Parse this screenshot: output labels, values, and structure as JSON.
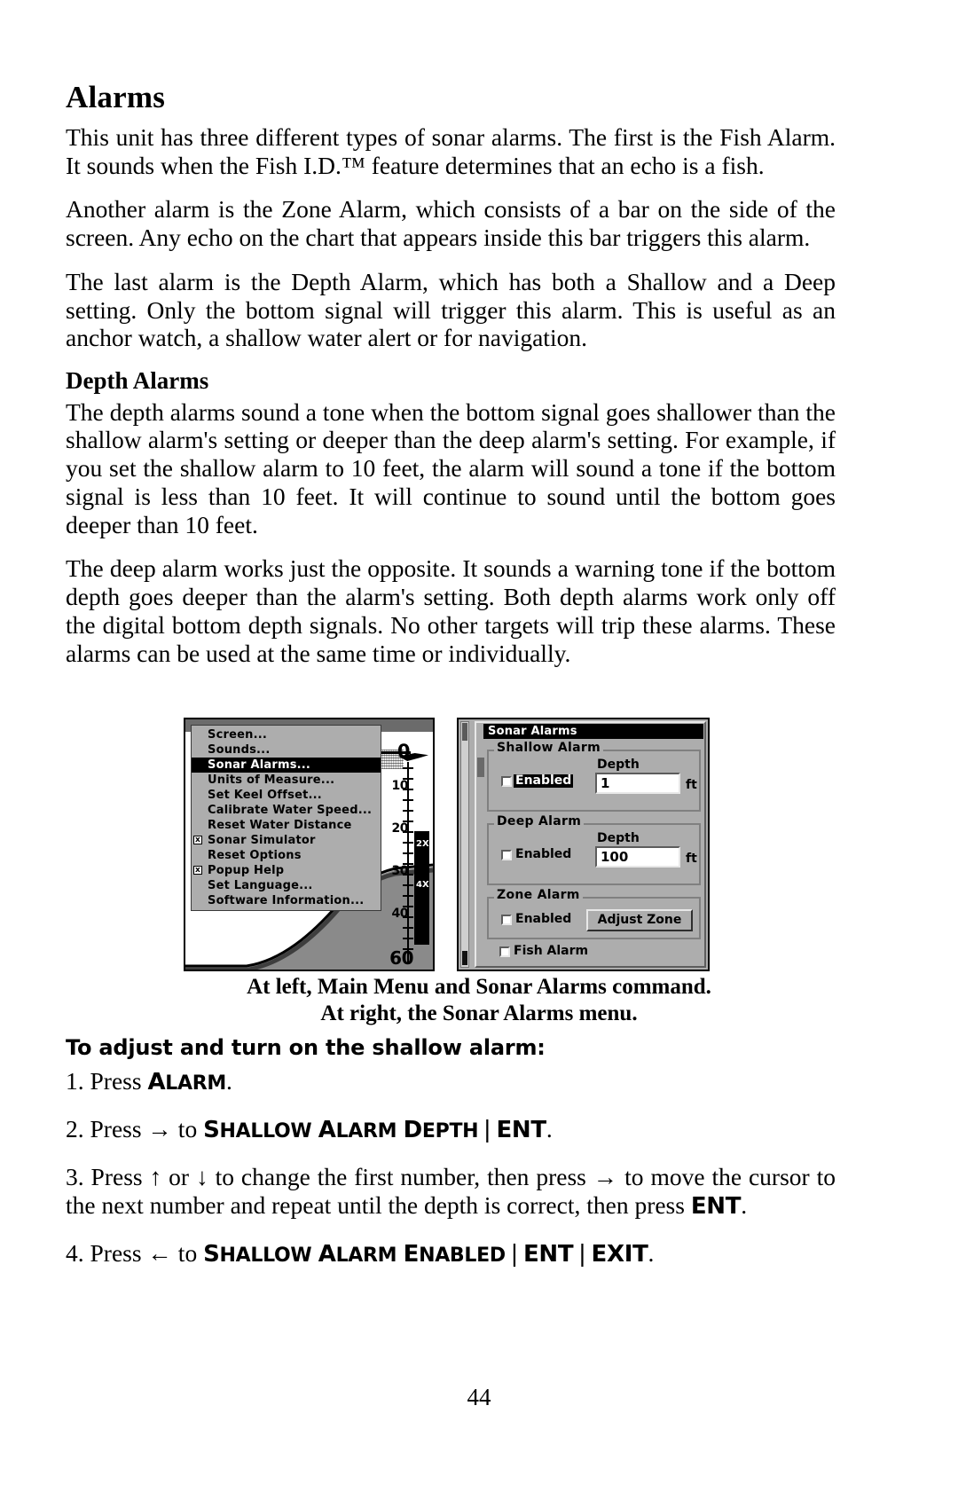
{
  "document": {
    "title": "Alarms",
    "page_number": "44"
  },
  "body": {
    "paragraphs": [
      "This unit has three different types of sonar alarms. The first is the Fish Alarm. It sounds when the Fish I.D.™ feature determines that an echo is a fish.",
      "Another alarm is the Zone Alarm, which consists of a bar on the side of the screen. Any echo on the chart that appears inside this bar triggers this alarm.",
      "The last alarm is the Depth Alarm, which has both a Shallow and a Deep setting. Only the bottom signal will trigger this alarm. This is useful as an anchor watch, a shallow water alert or for navigation."
    ],
    "subhead": "Depth Alarms",
    "subhead_paragraphs": [
      "The depth alarms sound a tone when the bottom signal goes shallower than the shallow alarm's setting or deeper than the deep alarm's setting. For example, if you set the shallow alarm to 10 feet, the alarm will sound a tone if the bottom signal is less than 10 feet. It will continue to sound until the bottom goes deeper than 10 feet.",
      "The deep alarm works just the opposite. It sounds a warning tone if the bottom depth goes deeper than the alarm's setting. Both depth alarms work only off the digital bottom depth signals. No other targets will trip these alarms. These alarms can be used at the same time or individually."
    ]
  },
  "figure": {
    "caption_line1": "At left, Main Menu and Sonar Alarms command.",
    "caption_line2": "At right, the Sonar Alarms menu.",
    "left_screenshot": {
      "menu_items": [
        {
          "label": "Screen...",
          "checkbox": false,
          "selected": false
        },
        {
          "label": "Sounds...",
          "checkbox": false,
          "selected": false
        },
        {
          "label": "Sonar Alarms...",
          "checkbox": false,
          "selected": true
        },
        {
          "label": "Units of Measure...",
          "checkbox": false,
          "selected": false
        },
        {
          "label": "Set Keel Offset...",
          "checkbox": false,
          "selected": false
        },
        {
          "label": "Calibrate Water Speed...",
          "checkbox": false,
          "selected": false
        },
        {
          "label": "Reset Water Distance",
          "checkbox": false,
          "selected": false
        },
        {
          "label": "Sonar Simulator",
          "checkbox": true,
          "checked": true,
          "selected": false
        },
        {
          "label": "Reset Options",
          "checkbox": false,
          "selected": false
        },
        {
          "label": "Popup Help",
          "checkbox": true,
          "checked": true,
          "selected": false
        },
        {
          "label": "Set Language...",
          "checkbox": false,
          "selected": false
        },
        {
          "label": "Software Information...",
          "checkbox": false,
          "selected": false
        }
      ],
      "depth_scale": [
        "0",
        "10",
        "20",
        "30",
        "40",
        "60"
      ],
      "zone_bar_labels": [
        "2X",
        "4X"
      ]
    },
    "right_screenshot": {
      "title": "Sonar Alarms",
      "shallow_alarm": {
        "group_label": "Shallow Alarm",
        "enabled_label": "Enabled",
        "enabled_checked": false,
        "enabled_highlighted": true,
        "depth_label": "Depth",
        "depth_value": "1",
        "unit": "ft"
      },
      "deep_alarm": {
        "group_label": "Deep Alarm",
        "enabled_label": "Enabled",
        "enabled_checked": false,
        "enabled_highlighted": false,
        "depth_label": "Depth",
        "depth_value": "100",
        "unit": "ft"
      },
      "zone_alarm": {
        "group_label": "Zone Alarm",
        "enabled_label": "Enabled",
        "enabled_checked": false,
        "button_label": "Adjust Zone"
      },
      "fish_alarm": {
        "label": "Fish Alarm",
        "checked": false
      }
    }
  },
  "procedure": {
    "heading": "To adjust and turn on the shallow alarm:",
    "steps": [
      {
        "number": "1.",
        "pre": "Press ",
        "keys": [
          "ALARM"
        ],
        "post": "."
      },
      {
        "number": "2.",
        "pre": "Press → to ",
        "keys": [
          "SHALLOW ALARM DEPTH",
          "ENT"
        ],
        "post": "."
      },
      {
        "number": "3.",
        "text": "Press ↑ or ↓ to change the first number, then press → to move the cursor to the next number and repeat until the depth is correct, then press ",
        "keys": [
          "ENT"
        ],
        "post": "."
      },
      {
        "number": "4.",
        "pre": "Press ← to ",
        "keys": [
          "SHALLOW ALARM ENABLED",
          "ENT",
          "EXIT"
        ],
        "post": "."
      }
    ]
  },
  "colors": {
    "page_background": "#ffffff",
    "text": "#000000",
    "device_gray": "#adadad",
    "device_dark": "#000000",
    "device_titlebar_gray": "#6b6b6b"
  }
}
